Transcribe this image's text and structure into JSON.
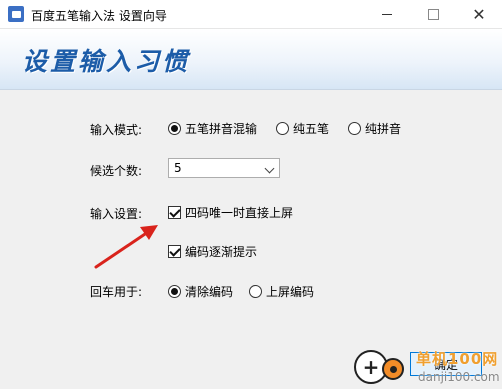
{
  "window": {
    "title": "百度五笔输入法 设置向导",
    "close_glyph": "✕"
  },
  "banner": {
    "title": "设置输入习惯"
  },
  "input_mode": {
    "label": "输入模式:",
    "options": [
      {
        "label": "五笔拼音混输",
        "selected": true
      },
      {
        "label": "纯五笔",
        "selected": false
      },
      {
        "label": "纯拼音",
        "selected": false
      }
    ]
  },
  "candidates": {
    "label": "候选个数:",
    "value": "5"
  },
  "input_settings": {
    "label": "输入设置:",
    "options": [
      {
        "label": "四码唯一时直接上屏",
        "checked": true
      },
      {
        "label": "编码逐渐提示",
        "checked": true
      }
    ]
  },
  "enter_key": {
    "label": "回车用于:",
    "options": [
      {
        "label": "清除编码",
        "selected": true
      },
      {
        "label": "上屏编码",
        "selected": false
      }
    ]
  },
  "footer": {
    "ok_label": "确定"
  },
  "watermark": {
    "title": "单机100网",
    "url": "danji100.com"
  },
  "colors": {
    "banner_title": "#1c5ca8",
    "arrow": "#d9231c",
    "ok_border": "#0078d7"
  }
}
